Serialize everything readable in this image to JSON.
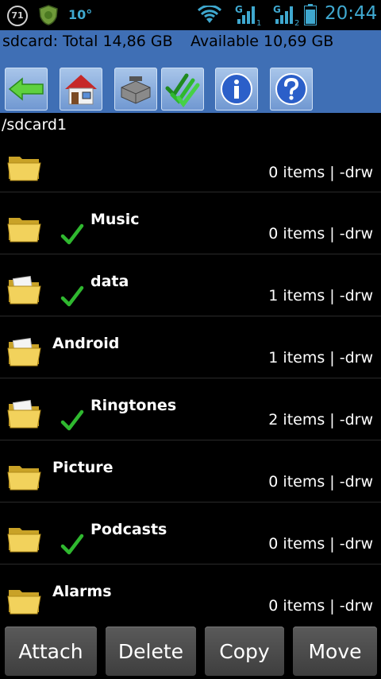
{
  "status_bar": {
    "badge": "71",
    "temperature": "10°",
    "signal1_sub": "1",
    "signal2_sub": "2",
    "signal_letter": "G",
    "time": "20:44",
    "shield_icon": "shield-icon",
    "wifi_icon": "wifi-icon",
    "battery_icon": "battery-icon"
  },
  "storage": {
    "total": "sdcard: Total 14,86 GB",
    "available": "Available 10,69 GB"
  },
  "toolbar": {
    "buttons": [
      {
        "icon": "back-arrow-icon"
      },
      {
        "icon": "home-icon"
      },
      {
        "icon": "toolbox-icon"
      },
      {
        "icon": "multi-select-icon"
      },
      {
        "icon": "info-icon"
      },
      {
        "icon": "help-icon"
      }
    ]
  },
  "path": "/sdcard1",
  "files": [
    {
      "name": "",
      "meta": "0 items | -drw",
      "checked": false,
      "has_docs": false
    },
    {
      "name": "Music",
      "meta": "0 items | -drw",
      "checked": true,
      "has_docs": false
    },
    {
      "name": "data",
      "meta": "1 items | -drw",
      "checked": true,
      "has_docs": true
    },
    {
      "name": "Android",
      "meta": "1 items | -drw",
      "checked": false,
      "has_docs": true
    },
    {
      "name": "Ringtones",
      "meta": "2 items | -drw",
      "checked": true,
      "has_docs": true
    },
    {
      "name": "Picture",
      "meta": "0 items | -drw",
      "checked": false,
      "has_docs": false
    },
    {
      "name": "Podcasts",
      "meta": "0 items | -drw",
      "checked": true,
      "has_docs": false
    },
    {
      "name": "Alarms",
      "meta": "0 items | -drw",
      "checked": false,
      "has_docs": false
    }
  ],
  "actions": {
    "attach": "Attach",
    "delete": "Delete",
    "copy": "Copy",
    "move": "Move"
  },
  "colors": {
    "accent_blue": "#3f6fb5",
    "status_cyan": "#3fa8cf",
    "check_green": "#2fb82f"
  }
}
